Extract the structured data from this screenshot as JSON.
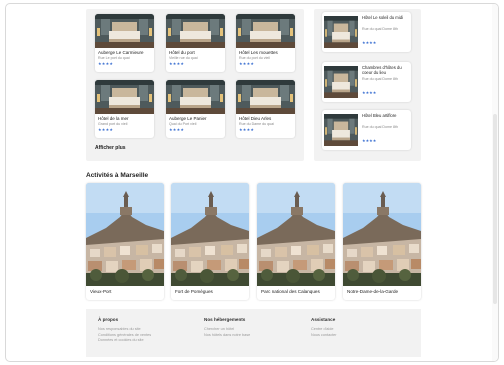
{
  "hotels_grid": [
    {
      "name": "Auberge Le Carmieure",
      "address": "Rue Le port du quai",
      "stars": "★★★★"
    },
    {
      "name": "Hôtel du port",
      "address": "Vieille rue du quai",
      "stars": "★★★★"
    },
    {
      "name": "Hôtel Les mouettes",
      "address": "Rue du port du vieil",
      "stars": "★★★★"
    },
    {
      "name": "Hôtel de la mer",
      "address": "Grand port du vieil",
      "stars": "★★★★"
    },
    {
      "name": "Auberge Le Panier",
      "address": "Quai du Port vieil",
      "stars": "★★★★"
    },
    {
      "name": "Hôtel Dieu Arles",
      "address": "Rue du Dame du quai",
      "stars": "★★★★"
    }
  ],
  "hotels_side": [
    {
      "name": "Hôtel Le soleil du midi",
      "address": "Rue du quai Dome 8th",
      "stars": "★★★★"
    },
    {
      "name": "Chambres d'hôtes du coeur du lieu",
      "address": "Rue du quai Dome 8th",
      "stars": "★★★★"
    },
    {
      "name": "Hôtel Bleu artiflore",
      "address": "Rue du quai Dome 8th",
      "stars": "★★★★"
    }
  ],
  "show_more_label": "Afficher plus",
  "activities_title": "Activités à Marseille",
  "activities": [
    {
      "label": "Vieux-Port"
    },
    {
      "label": "Fort de Pomègues"
    },
    {
      "label": "Parc national des Calanques"
    },
    {
      "label": "Notre-Dame-de-la-Garde"
    }
  ],
  "footer": {
    "col1": {
      "heading": "À propos",
      "links": [
        "Nos responsables du site",
        "Conditions générales de ventes",
        "Données et cookies du site"
      ]
    },
    "col2": {
      "heading": "Nos hébergements",
      "links": [
        "Chercher un hôtel",
        "Nos hôtels dans notre base"
      ]
    },
    "col3": {
      "heading": "Assistance",
      "links": [
        "Centre d'aide",
        "Nous contacter"
      ]
    }
  },
  "colors": {
    "star": "#3a6fd1",
    "panel": "#f2f2f2",
    "sky": "#a8cdef"
  }
}
